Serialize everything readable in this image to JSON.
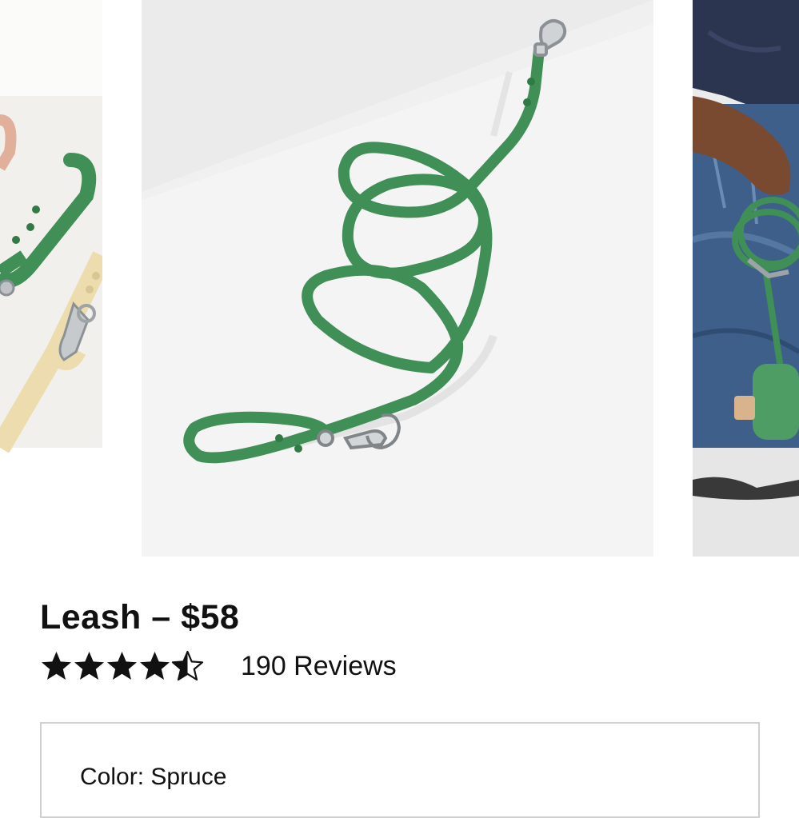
{
  "product": {
    "title": "Leash – $58",
    "rating": 4.5,
    "rating_max": 5,
    "reviews_label": "190 Reviews"
  },
  "options": {
    "color_label": "Color:",
    "color_value": "Spruce"
  },
  "carousel": {
    "active_index": 1,
    "slides": [
      {
        "name": "leashes-flatlay-image"
      },
      {
        "name": "spruce-leash-image"
      },
      {
        "name": "model-with-leash-image"
      }
    ]
  },
  "colors": {
    "spruce": "#3f8f56",
    "text": "#111111",
    "border": "#d0d0d0"
  }
}
